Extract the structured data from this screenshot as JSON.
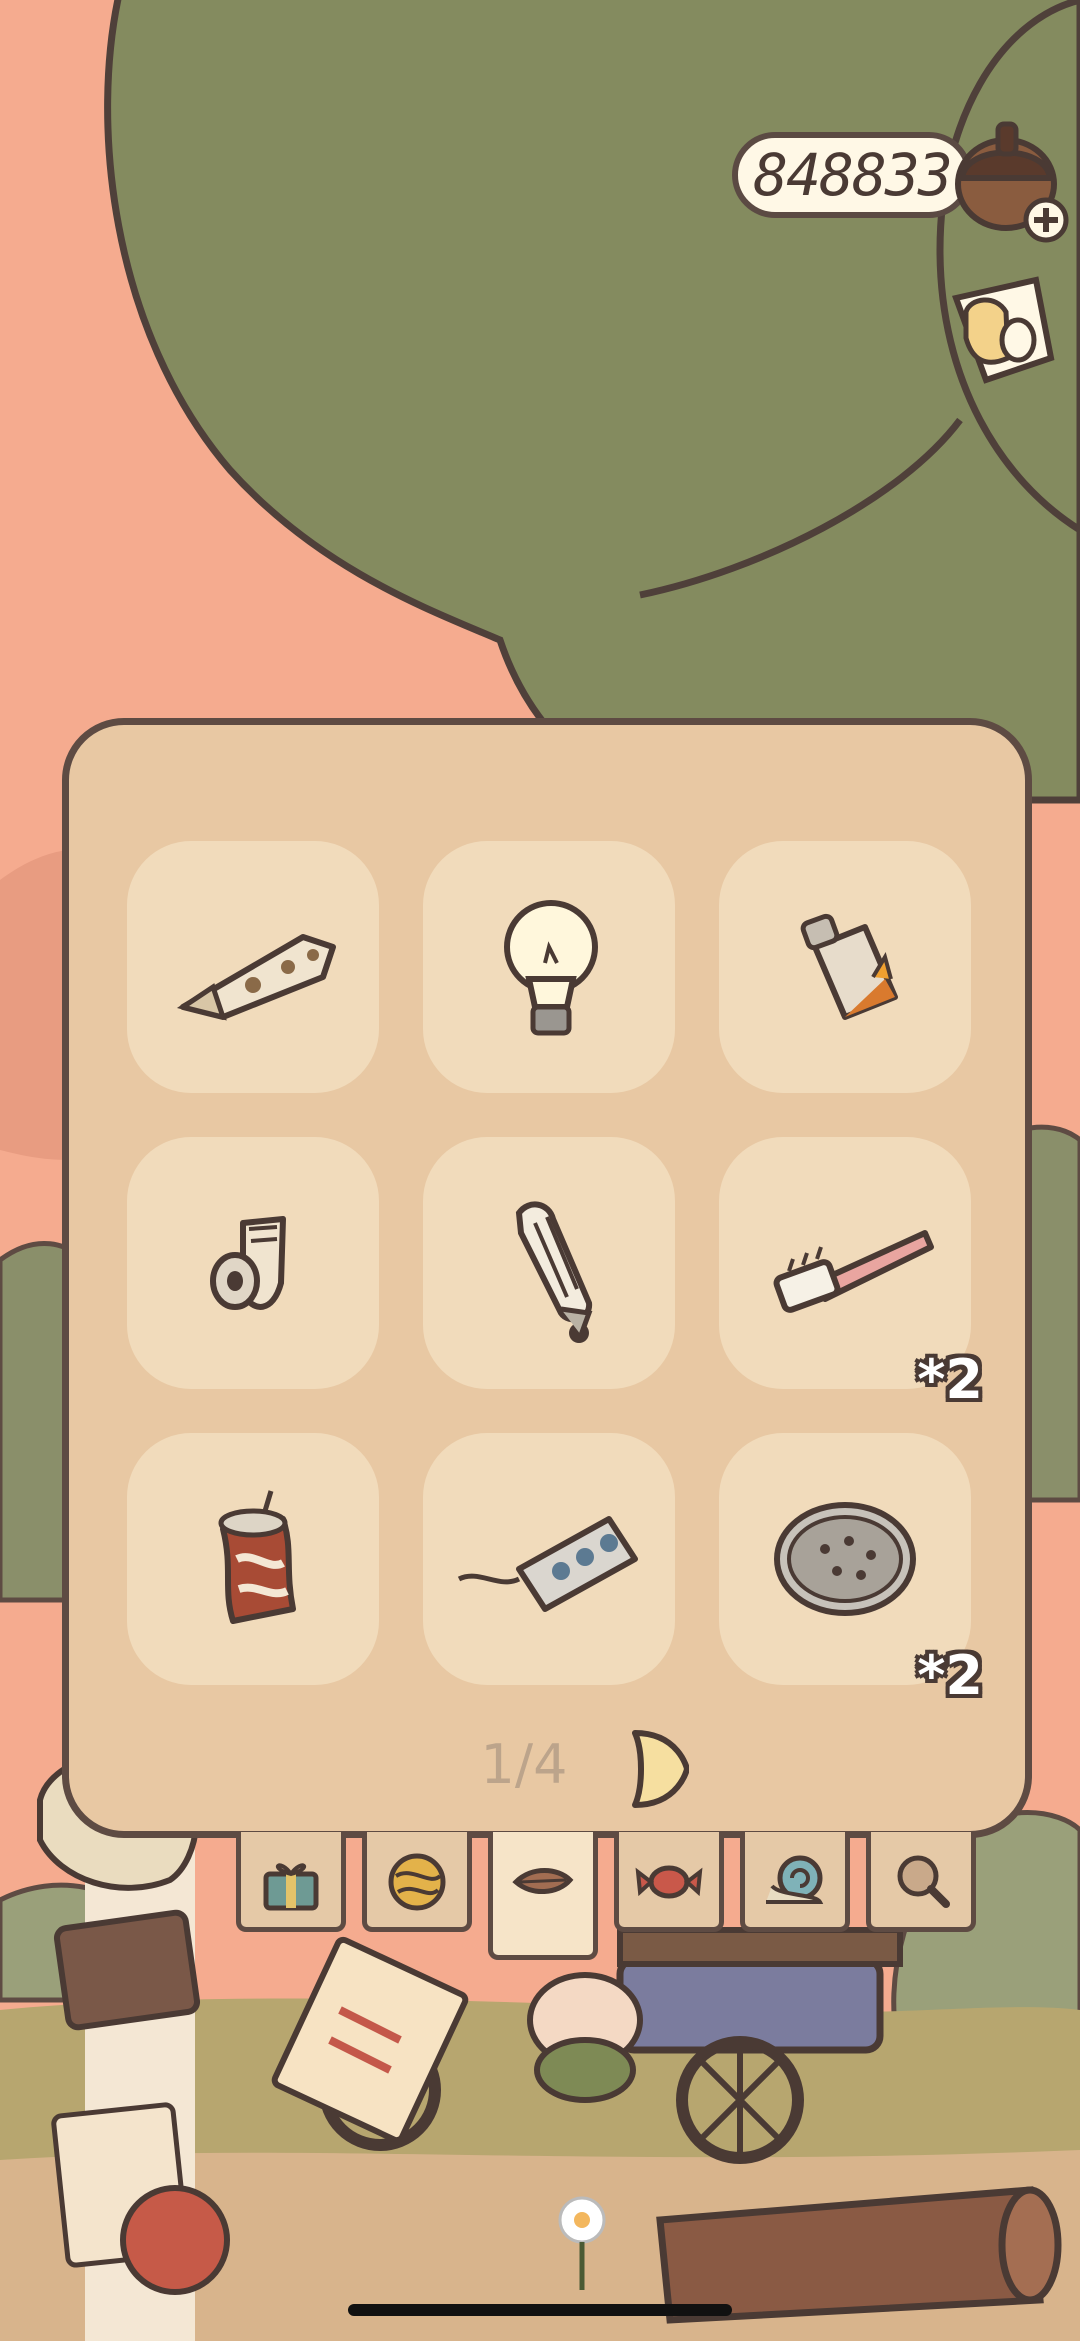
{
  "hud": {
    "currency_amount": "848833",
    "currency_icon": "acorn-icon",
    "currency_add_icon": "plus-icon",
    "side_icon": "cup-icon"
  },
  "inventory": {
    "items": [
      {
        "icon": "rusty-metal-plank-icon",
        "qty": ""
      },
      {
        "icon": "light-bulb-icon",
        "qty": ""
      },
      {
        "icon": "spray-can-icon",
        "qty": ""
      },
      {
        "icon": "broken-faucet-icon",
        "qty": ""
      },
      {
        "icon": "energy-saving-bulb-icon",
        "qty": ""
      },
      {
        "icon": "toothbrush-icon",
        "qty": "*2"
      },
      {
        "icon": "crushed-soda-can-icon",
        "qty": ""
      },
      {
        "icon": "power-strip-icon",
        "qty": ""
      },
      {
        "icon": "drain-cover-icon",
        "qty": "*2"
      }
    ],
    "page_indicator": "1/4",
    "next_icon": "next-page-icon"
  },
  "tabs": [
    {
      "icon": "gift-box-icon",
      "active": false
    },
    {
      "icon": "yarn-ball-icon",
      "active": false
    },
    {
      "icon": "leaf-icon",
      "active": true
    },
    {
      "icon": "candy-icon",
      "active": false
    },
    {
      "icon": "snail-icon",
      "active": false
    },
    {
      "icon": "magnifier-icon",
      "active": false
    }
  ],
  "colors": {
    "background": "#f5ab8f",
    "tree": "#848b5f",
    "panel": "#e8c8a3",
    "slot": "#f1dbbb",
    "outline": "#5e4b43"
  }
}
